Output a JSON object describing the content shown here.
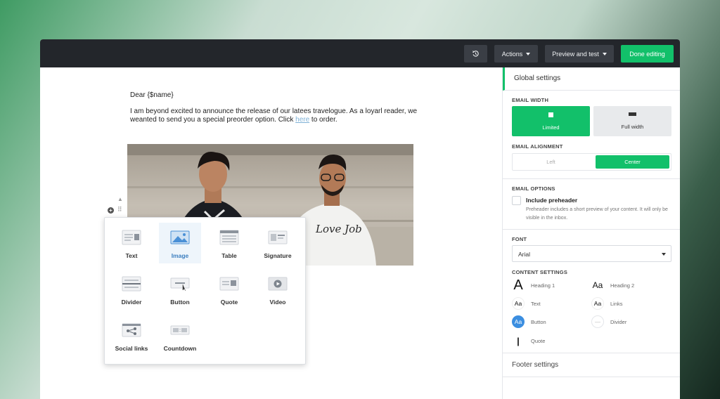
{
  "toolbar": {
    "history_icon": "history-icon",
    "actions_label": "Actions",
    "preview_label": "Preview and test",
    "done_label": "Done editing",
    "accent": "#12c06a"
  },
  "email": {
    "greeting": "Dear {$name}",
    "body_before": "I am beyond excited to announce the release of our latees travelogue. As a loyarl reader, we weanted to send you a special preorder option. Click ",
    "link_text": "here",
    "body_after": " to order.",
    "photo_shirt_text": "Love Job"
  },
  "blocks": [
    {
      "label": "Text",
      "icon": "text-block-icon"
    },
    {
      "label": "Image",
      "icon": "image-block-icon",
      "active": true
    },
    {
      "label": "Table",
      "icon": "table-block-icon"
    },
    {
      "label": "Signature",
      "icon": "signature-block-icon"
    },
    {
      "label": "Divider",
      "icon": "divider-block-icon"
    },
    {
      "label": "Button",
      "icon": "button-block-icon"
    },
    {
      "label": "Quote",
      "icon": "quote-block-icon"
    },
    {
      "label": "Video",
      "icon": "video-block-icon"
    },
    {
      "label": "Social links",
      "icon": "social-links-block-icon"
    },
    {
      "label": "Countdown",
      "icon": "countdown-block-icon"
    }
  ],
  "sidebar": {
    "title": "Global settings",
    "email_width_label": "EMAIL WIDTH",
    "width_limited": "Limited",
    "width_full": "Full width",
    "alignment_label": "EMAIL ALIGNMENT",
    "align_left": "Left",
    "align_center": "Center",
    "options_label": "EMAIL OPTIONS",
    "preheader_title": "Include preheader",
    "preheader_desc": "Preheader includes a short preview of your content. It will only be visible in the inbox.",
    "font_label": "FONT",
    "font_value": "Arial",
    "content_label": "CONTENT SETTINGS",
    "content_items": [
      {
        "label": "Heading 1",
        "glyph": "A"
      },
      {
        "label": "Heading 2",
        "glyph": "Aa"
      },
      {
        "label": "Text",
        "glyph": "Aa"
      },
      {
        "label": "Links",
        "glyph": "Aa"
      },
      {
        "label": "Button",
        "glyph": "Aa"
      },
      {
        "label": "Divider",
        "glyph": "—"
      },
      {
        "label": "Quote",
        "glyph": "|"
      }
    ],
    "footer_label": "Footer settings"
  }
}
